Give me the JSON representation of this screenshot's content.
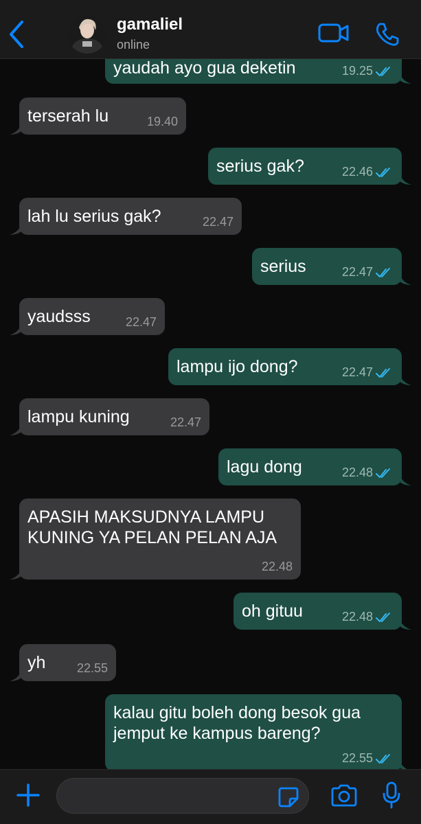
{
  "header": {
    "contact_name": "gamaliel",
    "status": "online"
  },
  "colors": {
    "background": "#0b0b0b",
    "incoming_bubble": "#3a3a3c",
    "outgoing_bubble": "#1f4f45",
    "accent": "#0a84ff",
    "read_ticks": "#34b7f1"
  },
  "messages": [
    {
      "direction": "out",
      "text": "yaudah ayo gua deketin",
      "time": "19.25",
      "read": true
    },
    {
      "direction": "in",
      "text": "terserah lu",
      "time": "19.40"
    },
    {
      "direction": "out",
      "text": "serius gak?",
      "time": "22.46",
      "read": true
    },
    {
      "direction": "in",
      "text": "lah lu serius gak?",
      "time": "22.47"
    },
    {
      "direction": "out",
      "text": "serius",
      "time": "22.47",
      "read": true
    },
    {
      "direction": "in",
      "text": "yaudsss",
      "time": "22.47"
    },
    {
      "direction": "out",
      "text": "lampu ijo dong?",
      "time": "22.47",
      "read": true
    },
    {
      "direction": "in",
      "text": "lampu kuning",
      "time": "22.47"
    },
    {
      "direction": "out",
      "text": "lagu dong",
      "time": "22.48",
      "read": true
    },
    {
      "direction": "in",
      "text": "APASIH MAKSUDNYA LAMPU\nKUNING YA PELAN PELAN AJA",
      "time": "22.48"
    },
    {
      "direction": "out",
      "text": "oh gituu",
      "time": "22.48",
      "read": true
    },
    {
      "direction": "in",
      "text": "yh",
      "time": "22.55"
    },
    {
      "direction": "out",
      "text": "kalau gitu boleh dong besok gua\njemput ke kampus bareng?",
      "time": "22.55",
      "read": true
    }
  ],
  "composer": {
    "input_value": ""
  },
  "icons": {
    "back": "chevron-left-icon",
    "video": "video-camera-icon",
    "call": "phone-icon",
    "plus": "plus-icon",
    "sticker": "sticker-icon",
    "camera": "camera-icon",
    "mic": "microphone-icon"
  }
}
